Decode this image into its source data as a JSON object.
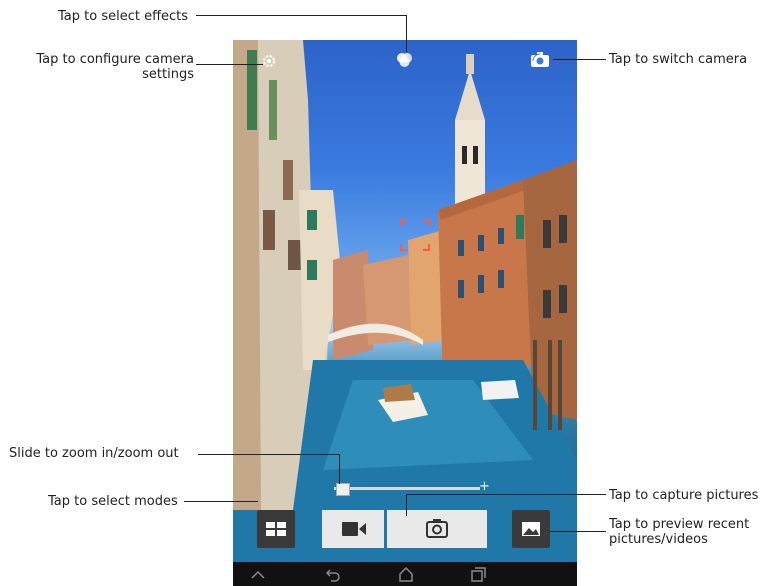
{
  "callouts": {
    "effects": "Tap to select effects",
    "settings_line1": "Tap to configure camera",
    "settings_line2": "settings",
    "switch_camera": "Tap to switch camera",
    "zoom": "Slide to zoom in/zoom out",
    "capture": "Tap to capture pictures",
    "modes": "Tap to select modes",
    "preview_line1": "Tap to preview recent",
    "preview_line2": "pictures/videos"
  },
  "zoom": {
    "plus_label": "+",
    "level": 0
  },
  "icons": {
    "effects": "effects-icon",
    "settings": "gear-icon",
    "switch_camera": "switch-camera-icon",
    "modes": "grid-icon",
    "video": "video-camera-icon",
    "capture": "camera-icon",
    "gallery": "image-icon",
    "nav_up": "up-icon",
    "nav_back": "back-icon",
    "nav_home": "home-icon",
    "nav_recent": "recent-apps-icon"
  },
  "colors": {
    "control_bg": "#e9e9e9",
    "dark_button": "#3a3a3a",
    "nav_bar": "#111111"
  }
}
